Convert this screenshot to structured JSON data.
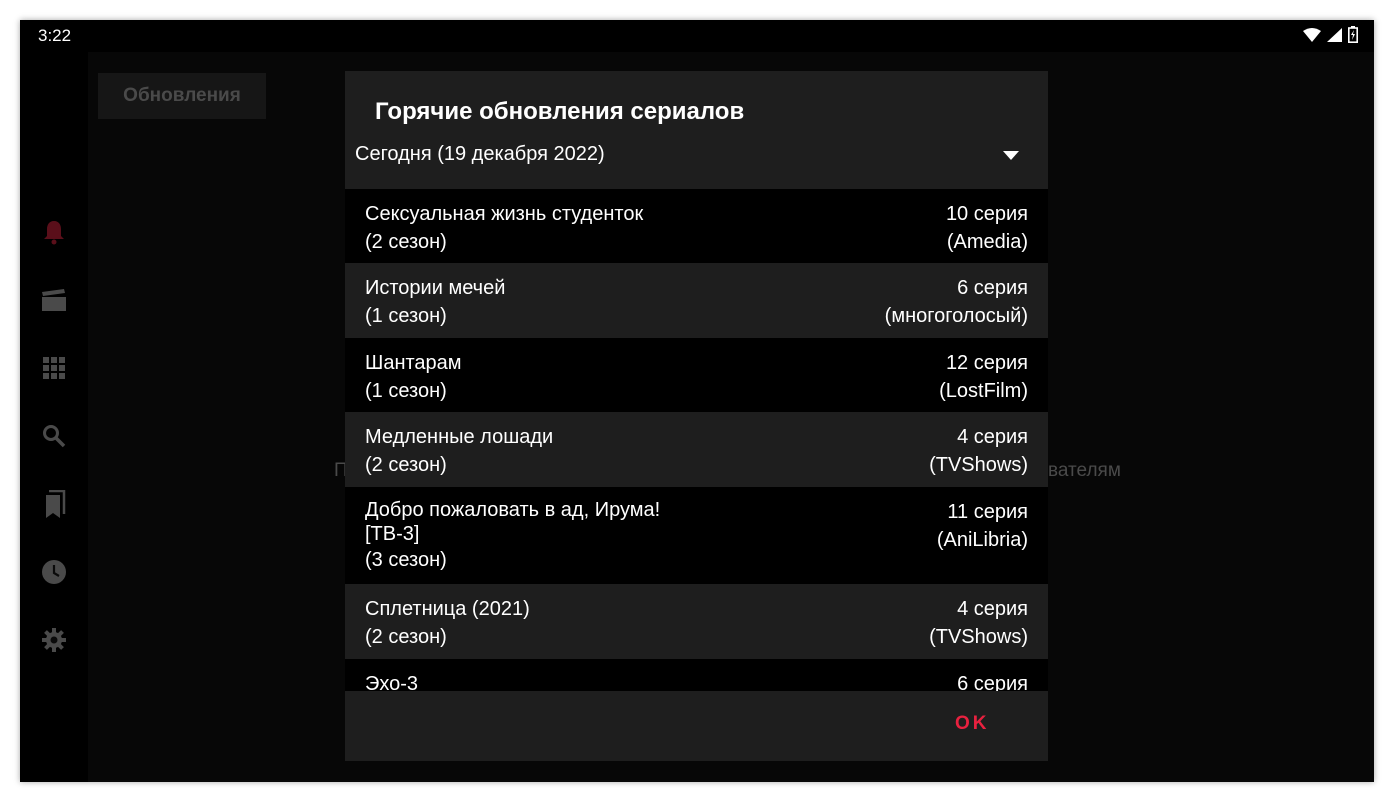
{
  "status_bar": {
    "time": "3:22"
  },
  "background": {
    "tab_label": "Обновления",
    "hint_left": "П",
    "hint_right": "вателям"
  },
  "dialog": {
    "title": "Горячие обновления сериалов",
    "date_selected": "Сегодня (19 декабря 2022)",
    "items": [
      {
        "title": "Сексуальная жизнь студенток",
        "season": "(2 сезон)",
        "episode": "10 серия",
        "voice": "(Amedia)"
      },
      {
        "title": "Истории мечей",
        "season": "(1 сезон)",
        "episode": "6 серия",
        "voice": "(многоголосый)"
      },
      {
        "title": "Шантарам",
        "season": "(1 сезон)",
        "episode": "12 серия",
        "voice": "(LostFilm)"
      },
      {
        "title": "Медленные лошади",
        "season": "(2 сезон)",
        "episode": "4 серия",
        "voice": "(TVShows)"
      },
      {
        "title": "Добро пожаловать в ад, Ирума!\n[ТВ-3]",
        "season": "(3 сезон)",
        "episode": "11 серия",
        "voice": "(AniLibria)"
      },
      {
        "title": "Сплетница (2021)",
        "season": "(2 сезон)",
        "episode": "4 серия",
        "voice": "(TVShows)"
      },
      {
        "title": "Эхо-3",
        "season": "",
        "episode": "6 серия",
        "voice": ""
      }
    ],
    "ok_label": "OK"
  },
  "colors": {
    "accent": "#e8213f",
    "dialog_surface": "#1e1e1e",
    "background": "#000000"
  },
  "sidebar_icons": [
    "bell-icon",
    "clapperboard-icon",
    "grid-icon",
    "search-icon",
    "bookmarks-icon",
    "clock-icon",
    "gear-icon"
  ]
}
